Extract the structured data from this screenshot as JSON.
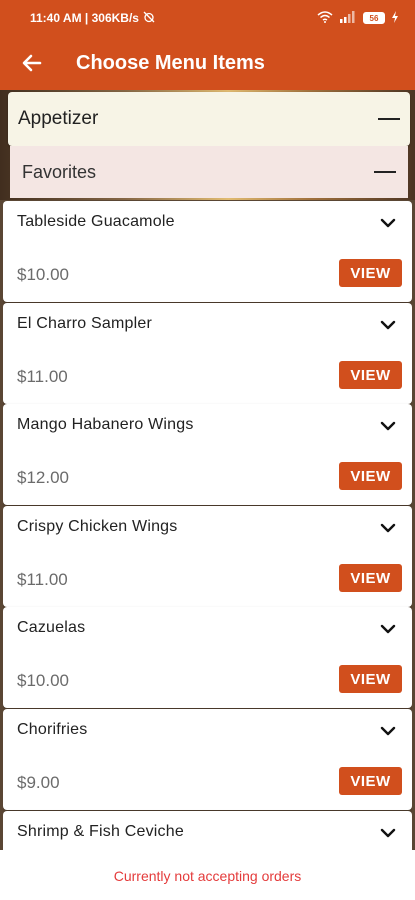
{
  "status_bar": {
    "time": "11:40 AM | 306KB/s",
    "battery": "56"
  },
  "header": {
    "title": "Choose Menu Items"
  },
  "category": {
    "label": "Appetizer"
  },
  "subcategory": {
    "label": "Favorites"
  },
  "items": [
    {
      "name": "Tableside Guacamole",
      "price": "$10.00",
      "button": "VIEW"
    },
    {
      "name": "El Charro Sampler",
      "price": "$11.00",
      "button": "VIEW"
    },
    {
      "name": "Mango Habanero Wings",
      "price": "$12.00",
      "button": "VIEW"
    },
    {
      "name": "Crispy Chicken Wings",
      "price": "$11.00",
      "button": "VIEW"
    },
    {
      "name": "Cazuelas",
      "price": "$10.00",
      "button": "VIEW"
    },
    {
      "name": "Chorifries",
      "price": "$9.00",
      "button": "VIEW"
    },
    {
      "name": "Shrimp & Fish Ceviche",
      "price": "",
      "button": ""
    }
  ],
  "footer": {
    "message": "Currently not accepting orders"
  },
  "colors": {
    "brand": "#d14f1d",
    "error_text": "#e43b3b"
  }
}
